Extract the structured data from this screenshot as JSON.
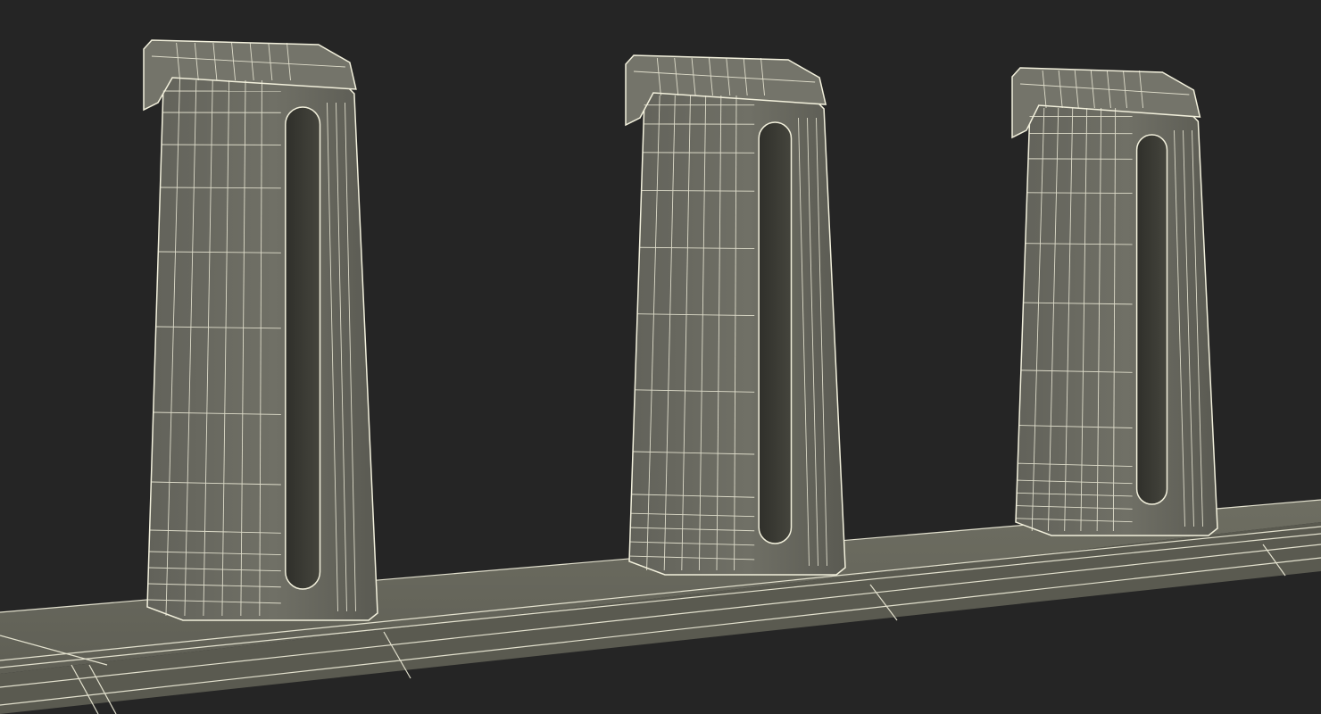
{
  "scene": {
    "background_color": "#252525",
    "surface_color": "#6b6b5f",
    "surface_dark_color": "#55554b",
    "slot_color": "#3a3a33",
    "wire_color": "#f2f0dc",
    "objects": [
      "base-rail",
      "hook-post-left",
      "hook-post-middle",
      "hook-post-right"
    ]
  }
}
